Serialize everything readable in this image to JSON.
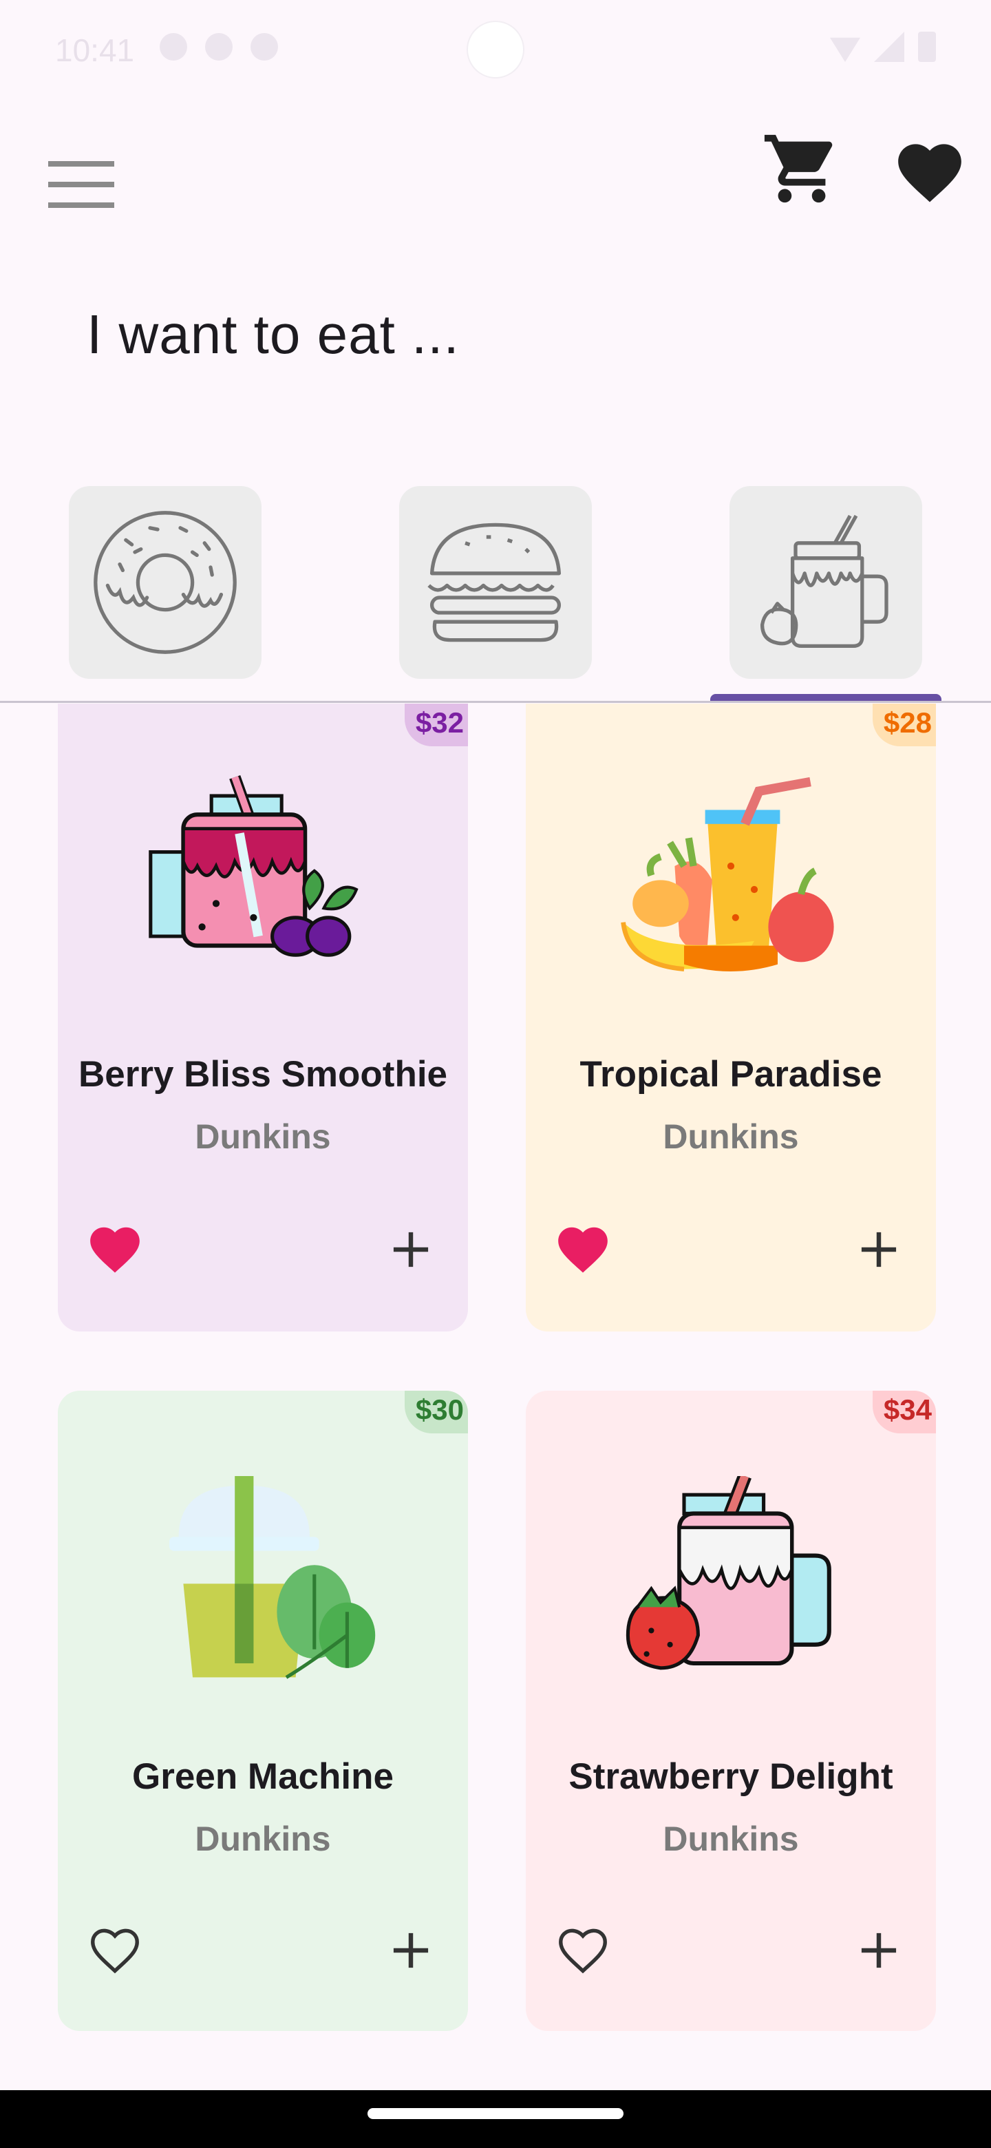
{
  "status_bar": {
    "time": "10:41",
    "icons_left": [
      "dnd-icon",
      "sd-card-icon",
      "sync-icon"
    ],
    "icons_right": [
      "wifi-icon",
      "signal-icon",
      "battery-icon"
    ]
  },
  "header": {
    "menu_icon": "hamburger-menu-icon",
    "cart_icon": "shopping-cart-icon",
    "favorites_icon": "heart-icon"
  },
  "headline": "I want to eat ...",
  "categories": [
    {
      "icon": "donut-icon",
      "selected": false
    },
    {
      "icon": "burger-icon",
      "selected": false
    },
    {
      "icon": "smoothie-jar-icon",
      "selected": true
    }
  ],
  "products": [
    {
      "name": "Berry Bliss Smoothie",
      "vendor": "Dunkins",
      "price": "$32",
      "favorite": true,
      "image": "berry-smoothie-image",
      "color": "#f3e5f5"
    },
    {
      "name": "Tropical Paradise",
      "vendor": "Dunkins",
      "price": "$28",
      "favorite": true,
      "image": "tropical-juice-image",
      "color": "#fff3e0"
    },
    {
      "name": "Green Machine",
      "vendor": "Dunkins",
      "price": "$30",
      "favorite": false,
      "image": "green-smoothie-image",
      "color": "#e8f5e9"
    },
    {
      "name": "Strawberry Delight",
      "vendor": "Dunkins",
      "price": "$34",
      "favorite": false,
      "image": "strawberry-shake-image",
      "color": "#ffebee"
    }
  ],
  "colors": {
    "accent": "#6750a4",
    "favorite_active": "#e91e63",
    "background": "#fdf7fc"
  }
}
